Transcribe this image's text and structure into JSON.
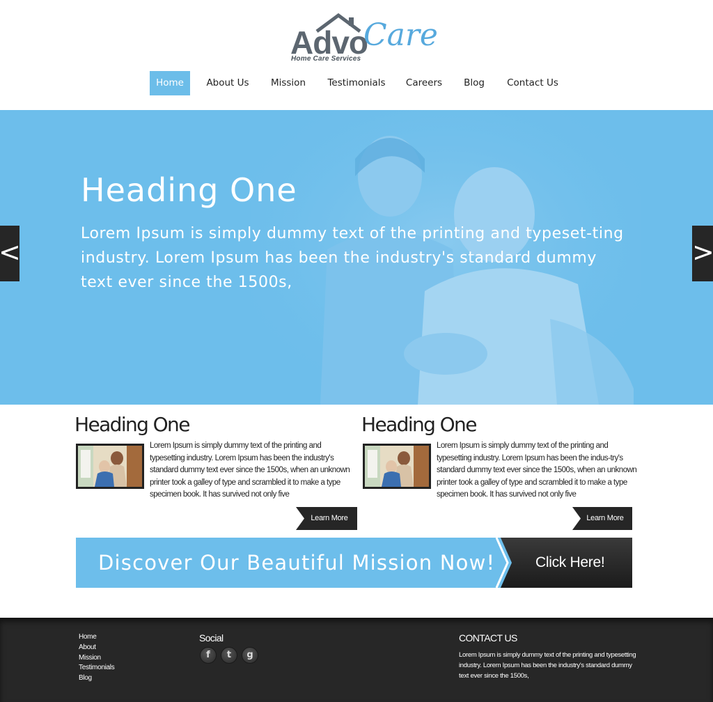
{
  "logo": {
    "part1": "Advo",
    "part2": "Care",
    "tagline": "Home Care Services"
  },
  "nav": {
    "items": [
      {
        "label": "Home",
        "active": true
      },
      {
        "label": "About Us"
      },
      {
        "label": "Mission"
      },
      {
        "label": "Testimonials"
      },
      {
        "label": "Careers"
      },
      {
        "label": "Blog"
      },
      {
        "label": "Contact Us"
      }
    ]
  },
  "hero": {
    "title": "Heading One",
    "text": "Lorem Ipsum is simply dummy text of the printing and typeset-ting industry. Lorem Ipsum has been the industry's standard dummy text ever since the 1500s,",
    "prev_label": "<",
    "next_label": ">"
  },
  "columns": [
    {
      "heading": "Heading One",
      "text": "Lorem Ipsum is simply dummy text of the printing and typesetting industry. Lorem Ipsum has been the industry's standard dummy text ever since the 1500s, when an unknown printer took a galley of type and scrambled it to make a type specimen book. It has survived not only five",
      "button": "Learn More"
    },
    {
      "heading": "Heading One",
      "text": "Lorem Ipsum is simply dummy text of the printing and typesetting industry. Lorem Ipsum has been the indus-try's standard dummy text ever since the 1500s, when an unknown printer took a galley of type and scrambled it to make a type specimen book. It has survived not only five",
      "button": "Learn More"
    }
  ],
  "banner": {
    "text": "Discover Our Beautiful Mission Now!",
    "button": "Click Here!"
  },
  "footer": {
    "links": [
      "Home",
      "About",
      "Mission",
      "Testimonials",
      "Blog"
    ],
    "social_title": "Social",
    "social_icons": [
      {
        "name": "facebook-icon",
        "glyph": "f"
      },
      {
        "name": "twitter-icon",
        "glyph": "t"
      },
      {
        "name": "google-icon",
        "glyph": "g"
      }
    ],
    "contact_title": "CONTACT US",
    "contact_text": "Lorem Ipsum is simply dummy text of the printing and typesetting industry. Lorem Ipsum has been the industry's standard dummy text ever since the 1500s,"
  },
  "colors": {
    "accent": "#6dbeeb",
    "dark": "#262626",
    "footer": "#272727"
  }
}
